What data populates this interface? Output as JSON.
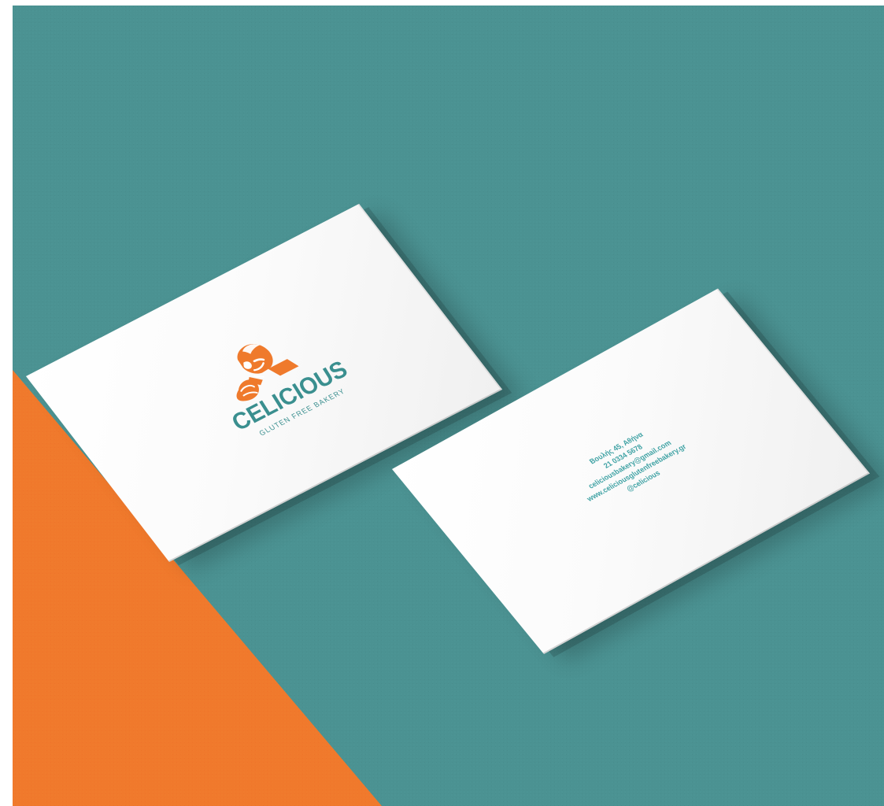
{
  "scene": {
    "colors": {
      "background": "#4b9292",
      "orange": "#f0792c",
      "card": "#ffffff",
      "brand_teal": "#3a8f8f",
      "brand_orange": "#ef7a2c"
    }
  },
  "front_card": {
    "brand": "CELICIOUS",
    "tagline": "GLUTEN FREE BAKERY",
    "mascot_icon": "baker-mascot-icon"
  },
  "back_card": {
    "contact": {
      "address": "Βουλής 45, Αθήνα",
      "phone": "21 0334 5678",
      "email": "celiciousbakery@gmail.com",
      "website": "www.celiciousglutenfreebakery.gr",
      "handle": "@celicious"
    }
  }
}
